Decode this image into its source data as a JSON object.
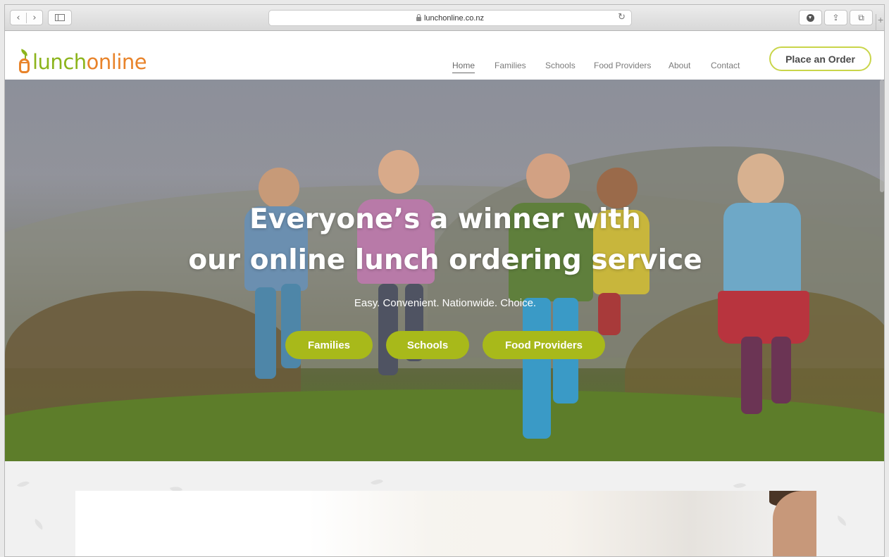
{
  "browser": {
    "url": "lunchonline.co.nz",
    "back_glyph": "‹",
    "forward_glyph": "›",
    "reload_glyph": "↻",
    "share_glyph": "⇪",
    "tabs_glyph": "⧉",
    "newtab_glyph": "+"
  },
  "logo": {
    "part1": "lunch",
    "part2": "online"
  },
  "nav": {
    "items": [
      {
        "label": "Home",
        "active": true
      },
      {
        "label": "Families"
      },
      {
        "label": "Schools"
      },
      {
        "label": "Food Providers"
      },
      {
        "label": "About"
      },
      {
        "label": "Contact"
      }
    ],
    "cta": "Place an Order"
  },
  "hero": {
    "title_line1": "Everyone’s a winner with",
    "title_line2": "our online lunch ordering service",
    "subtitle": "Easy. Convenient. Nationwide. Choice.",
    "buttons": [
      "Families",
      "Schools",
      "Food Providers"
    ]
  },
  "colors": {
    "brand_green": "#8cb41c",
    "brand_orange": "#e8832a",
    "button_green": "#a8b91a",
    "cta_border": "#c9d54a"
  }
}
